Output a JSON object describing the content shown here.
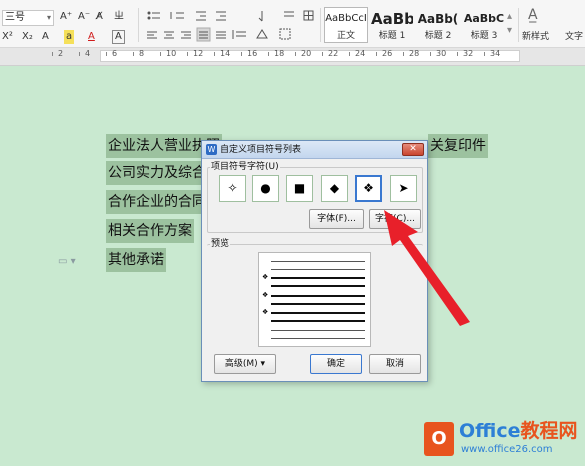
{
  "ribbon": {
    "font_size_value": "三号",
    "grow_font": "A⁺",
    "shrink_font": "A⁻",
    "clear_format": "A̸",
    "phonetic": "ㄓ",
    "superscript": "X²",
    "subscript": "X₂",
    "font_effect": "A",
    "highlight": "a",
    "font_color": "A",
    "char_border": "A",
    "styles": [
      {
        "sample": "AaBbCcI",
        "name": "正文"
      },
      {
        "sample": "AaBb",
        "name": "标题 1"
      },
      {
        "sample": "AaBb(",
        "name": "标题 2"
      },
      {
        "sample": "AaBbC",
        "name": "标题 3"
      }
    ],
    "new_style_label": "新样式",
    "text_tool_label": "文字"
  },
  "ruler": {
    "numbers": [
      "2",
      "4",
      "6",
      "8",
      "10",
      "12",
      "14",
      "16",
      "18",
      "20",
      "22",
      "24",
      "26",
      "28",
      "30",
      "32",
      "34"
    ]
  },
  "document": {
    "lines": [
      "企业法人营业执照",
      "公司实力及综合",
      "合作企业的合同",
      "相关合作方案",
      "其他承诺"
    ],
    "line_right_fragment": "关复印件"
  },
  "dialog": {
    "title": "自定义项目符号列表",
    "group_label": "项目符号字符(U)",
    "bullets": [
      "✧",
      "●",
      "■",
      "◆",
      "❖",
      "➤"
    ],
    "selected_index": 4,
    "font_button": "字体(F)...",
    "char_button": "字符(C)...",
    "preview_label": "预览",
    "advanced_button": "高级(M) ▾",
    "ok_button": "确定",
    "cancel_button": "取消",
    "preview_bullet": "❖"
  },
  "watermark": {
    "logo_glyph": "O",
    "title_part1": "Office",
    "title_part2": "教程网",
    "url": "www.office26.com"
  },
  "colors": {
    "page_background": "#c9e9d0",
    "text_highlight": "#9cc29f",
    "arrow": "#e8202a",
    "selection_border": "#3a78d0"
  }
}
